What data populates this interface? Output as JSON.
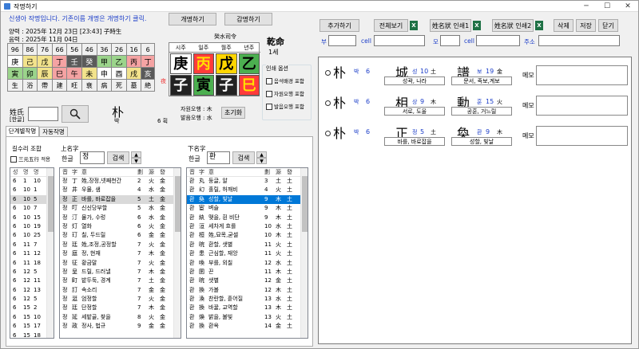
{
  "window": {
    "title": "작명하기",
    "minimize": "─",
    "maximize": "☐",
    "close": "✕"
  },
  "notice": "신생아 작명입니다.  기존이름 개명은 개명하기 클릭.",
  "buttons": {
    "rename": "개명하기",
    "appraise": "감명하기",
    "lookup": "초기화",
    "search": "검색",
    "add": "추가하기",
    "view_all": "전체보기",
    "print1": "姓名狀 인쇄1",
    "print2": "姓名狀 인쇄2",
    "delete": "삭제",
    "save": "저장",
    "close": "닫기"
  },
  "birth": {
    "solar": "양력 : 2025年  12月  23日  [23:43] 子時生",
    "lunar": "음력 : 2025年  11月  04日"
  },
  "saju_grid": {
    "row1": [
      "96",
      "86",
      "76",
      "66",
      "56",
      "46",
      "36",
      "26",
      "16",
      "6"
    ],
    "row2": [
      "庚",
      "己",
      "戊",
      "丁",
      "壬",
      "癸",
      "甲",
      "乙",
      "丙",
      "丁"
    ],
    "row3": [
      "寅",
      "卯",
      "辰",
      "巳",
      "午",
      "未",
      "申",
      "酉",
      "戌",
      "亥"
    ],
    "row4": [
      "生",
      "浴",
      "帶",
      "建",
      "旺",
      "衰",
      "病",
      "死",
      "墓",
      "絶"
    ]
  },
  "pillars": {
    "header": "癸水司令",
    "labels": [
      "시주",
      "일주",
      "월주",
      "년주"
    ],
    "top": [
      "庚",
      "丙",
      "戊",
      "乙"
    ],
    "bottom": [
      "子",
      "寅",
      "子",
      "巳"
    ],
    "side_label": "夜"
  },
  "fate": {
    "title": "乾命",
    "age": "1세"
  },
  "options": {
    "title": "인쇄 옵션",
    "items": [
      "음석배경 포함",
      "자원오행 포함",
      "발음오행 포함"
    ]
  },
  "surname": {
    "label": "姓氏",
    "sub": "[한글]",
    "hanja": "朴",
    "hangul": "박",
    "strokes": "6 획"
  },
  "elements": {
    "jawon": "자원오행 : 木",
    "bareum": "발음오행 : 水"
  },
  "tabs": [
    "단계별작명",
    "자동작명"
  ],
  "gilsu": {
    "title": "길수리 조합",
    "option": "三元五行 적용",
    "headers": [
      "성",
      "명",
      "명"
    ],
    "rows": [
      [
        "6",
        "1",
        "10"
      ],
      [
        "6",
        "10",
        "1"
      ],
      [
        "6",
        "10",
        "5"
      ],
      [
        "6",
        "10",
        "7"
      ],
      [
        "6",
        "10",
        "15"
      ],
      [
        "6",
        "10",
        "19"
      ],
      [
        "6",
        "10",
        "25"
      ],
      [
        "6",
        "11",
        "7"
      ],
      [
        "6",
        "11",
        "12"
      ],
      [
        "6",
        "11",
        "18"
      ],
      [
        "6",
        "12",
        "5"
      ],
      [
        "6",
        "12",
        "11"
      ],
      [
        "6",
        "12",
        "13"
      ],
      [
        "6",
        "12",
        "5"
      ],
      [
        "6",
        "15",
        "2"
      ],
      [
        "6",
        "15",
        "10"
      ],
      [
        "6",
        "15",
        "17"
      ],
      [
        "6",
        "15",
        "18"
      ]
    ]
  },
  "upper": {
    "title": "上名字",
    "label": "한글",
    "value": "정",
    "headers": [
      "音",
      "字",
      "意",
      "劃",
      "源",
      "發"
    ],
    "rows": [
      [
        "정",
        "丁",
        "姓,장정,넷째천간",
        "2",
        "火",
        "金"
      ],
      [
        "정",
        "井",
        "우물, 샘",
        "4",
        "水",
        "金"
      ],
      [
        "정",
        "正",
        "바를, 바로잡을",
        "5",
        "土",
        "金"
      ],
      [
        "정",
        "叮",
        "신신당부할",
        "5",
        "水",
        "金"
      ],
      [
        "정",
        "汀",
        "물가, 수렁",
        "6",
        "水",
        "金"
      ],
      [
        "정",
        "灯",
        "열화",
        "6",
        "火",
        "金"
      ],
      [
        "정",
        "玎",
        "칠, 두드릴",
        "6",
        "金",
        "金"
      ],
      [
        "정",
        "廷",
        "姓,조정,공정할",
        "7",
        "火",
        "金"
      ],
      [
        "정",
        "庭",
        "정, 현재",
        "7",
        "木",
        "金"
      ],
      [
        "정",
        "征",
        "황금말",
        "7",
        "火",
        "金"
      ],
      [
        "정",
        "呈",
        "드릴, 드러낼",
        "7",
        "木",
        "金"
      ],
      [
        "정",
        "町",
        "밭두둑, 경계",
        "7",
        "土",
        "金"
      ],
      [
        "정",
        "訂",
        "속소리",
        "7",
        "金",
        "金"
      ],
      [
        "정",
        "涏",
        "엄정할",
        "7",
        "火",
        "金"
      ],
      [
        "정",
        "廷",
        "단정할",
        "7",
        "木",
        "金"
      ],
      [
        "정",
        "延",
        "세밭골, 찾을",
        "8",
        "火",
        "金"
      ],
      [
        "정",
        "政",
        "정사, 법규",
        "9",
        "金",
        "金"
      ]
    ]
  },
  "lower": {
    "title": "下名字",
    "label": "한글",
    "value": "환",
    "headers": [
      "音",
      "字",
      "意",
      "劃",
      "源",
      "發"
    ],
    "rows": [
      [
        "환",
        "丸",
        "둥글, 알",
        "3",
        "土",
        "土"
      ],
      [
        "환",
        "幻",
        "홀릴, 허깨비",
        "4",
        "火",
        "土"
      ],
      [
        "환",
        "奐",
        "성할, 빛날",
        "9",
        "木",
        "土"
      ],
      [
        "환",
        "宦",
        "벼슬",
        "9",
        "木",
        "土"
      ],
      [
        "환",
        "紈",
        "맺을, 흰 비단",
        "9",
        "木",
        "土"
      ],
      [
        "환",
        "洹",
        "세차게 흐를",
        "10",
        "水",
        "土"
      ],
      [
        "환",
        "桓",
        "姓,묘목,굳셀",
        "10",
        "木",
        "土"
      ],
      [
        "환",
        "晥",
        "환할, 샛별",
        "11",
        "火",
        "土"
      ],
      [
        "환",
        "患",
        "근심할, 재앙",
        "11",
        "火",
        "土"
      ],
      [
        "환",
        "喚",
        "부를, 외칠",
        "12",
        "水",
        "土"
      ],
      [
        "환",
        "圂",
        "끈",
        "11",
        "木",
        "土"
      ],
      [
        "환",
        "晥",
        "샛별",
        "12",
        "金",
        "土"
      ],
      [
        "환",
        "換",
        "가볼",
        "12",
        "木",
        "土"
      ],
      [
        "환",
        "渙",
        "찬란할, 흩어질",
        "13",
        "水",
        "土"
      ],
      [
        "환",
        "換",
        "바꿀, 교역할",
        "13",
        "木",
        "土"
      ],
      [
        "환",
        "煥",
        "밝을, 불빛",
        "13",
        "火",
        "土"
      ],
      [
        "환",
        "換",
        "환옥",
        "14",
        "金",
        "土"
      ]
    ]
  },
  "top_filters": {
    "bu": "부",
    "cell1": "cell",
    "mo": "모",
    "cell2": "cell",
    "addr": "주소"
  },
  "results": [
    {
      "sur": "朴",
      "sur_h": "박",
      "sur_n": "6",
      "c1": "城",
      "c1_h": "성",
      "c1_n": "10",
      "c1_e": "土",
      "c2": "譜",
      "c2_h": "보",
      "c2_n": "19",
      "c2_e": "金",
      "m1": "성곽, 나라",
      "m2": "문서, 족보,계보",
      "memo": "메모"
    },
    {
      "sur": "朴",
      "sur_h": "박",
      "sur_n": "6",
      "c1": "相",
      "c1_h": "상",
      "c1_n": "9",
      "c1_e": "木",
      "c2": "勳",
      "c2_h": "훈",
      "c2_n": "15",
      "c2_e": "火",
      "m1": "서로, 도울",
      "m2": "공훈, 거느릴",
      "memo": "메모"
    },
    {
      "sur": "朴",
      "sur_h": "박",
      "sur_n": "6",
      "c1": "正",
      "c1_h": "정",
      "c1_n": "5",
      "c1_e": "土",
      "c2": "奐",
      "c2_h": "환",
      "c2_n": "9",
      "c2_e": "木",
      "m1": "바를, 바로잡을",
      "m2": "성할, 빛날",
      "memo": "메모"
    }
  ],
  "colors": {
    "wood": "#4caf50",
    "fire": "#ff3b3b",
    "earth": "#ffd500",
    "metal": "#ffffff",
    "water": "#222222"
  }
}
